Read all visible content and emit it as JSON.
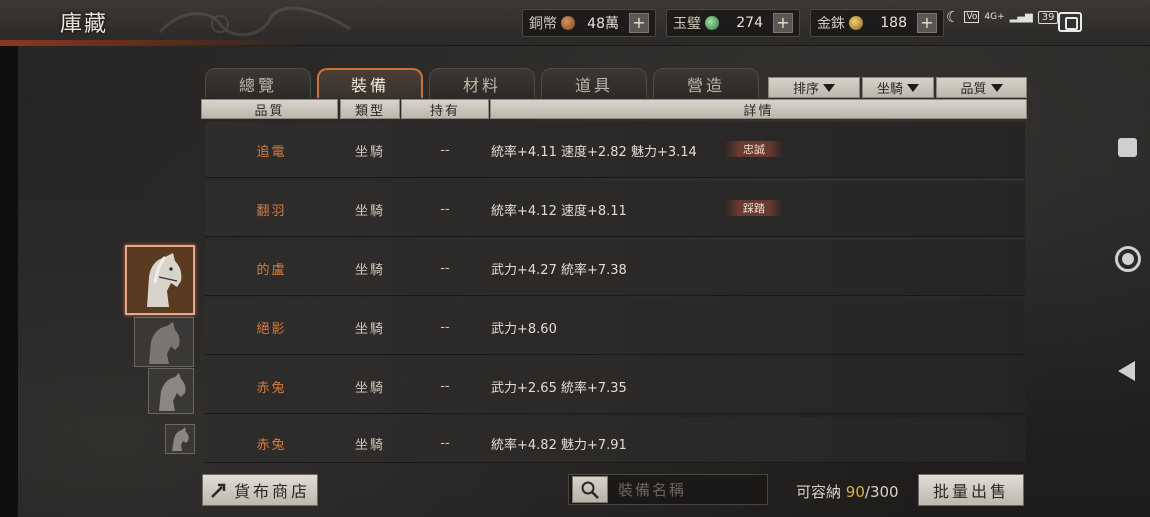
{
  "header": {
    "title": "庫藏"
  },
  "currencies": [
    {
      "name": "銅幣",
      "value": "48萬",
      "coin_color": "#b0703e"
    },
    {
      "name": "玉璧",
      "value": "274",
      "coin_color": "#3e8a4e"
    },
    {
      "name": "金銖",
      "value": "188",
      "coin_color": "#c8a040"
    }
  ],
  "status_bar": {
    "signal": "4G+",
    "battery": "39"
  },
  "tabs": [
    {
      "label": "總覽",
      "active": false
    },
    {
      "label": "裝備",
      "active": true
    },
    {
      "label": "材料",
      "active": false
    },
    {
      "label": "道具",
      "active": false
    },
    {
      "label": "營造",
      "active": false
    }
  ],
  "dropdowns": [
    {
      "label": "排序"
    },
    {
      "label": "坐騎"
    },
    {
      "label": "品質"
    }
  ],
  "columns": [
    "品質",
    "類型",
    "持有",
    "詳情"
  ],
  "rows": [
    {
      "name": "追電",
      "type": "坐騎",
      "owner": "--",
      "details": "統率+4.11  速度+2.82  魅力+3.14",
      "tag": "忠誠"
    },
    {
      "name": "翻羽",
      "type": "坐騎",
      "owner": "--",
      "details": "統率+4.12  速度+8.11",
      "tag": "踩踏"
    },
    {
      "name": "的盧",
      "type": "坐騎",
      "owner": "--",
      "details": "武力+4.27  統率+7.38",
      "tag": ""
    },
    {
      "name": "絕影",
      "type": "坐騎",
      "owner": "--",
      "details": "武力+8.60",
      "tag": ""
    },
    {
      "name": "赤兔",
      "type": "坐騎",
      "owner": "--",
      "details": "武力+2.65  統率+7.35",
      "tag": ""
    },
    {
      "name": "赤兔",
      "type": "坐騎",
      "owner": "--",
      "details": "統率+4.82  魅力+7.91",
      "tag": ""
    }
  ],
  "footer": {
    "shop_button": "貨布商店",
    "search_placeholder": "裝備名稱",
    "capacity_label": "可容納",
    "capacity_current": "90",
    "capacity_max": "/300",
    "bulk_sell_button": "批量出售"
  }
}
